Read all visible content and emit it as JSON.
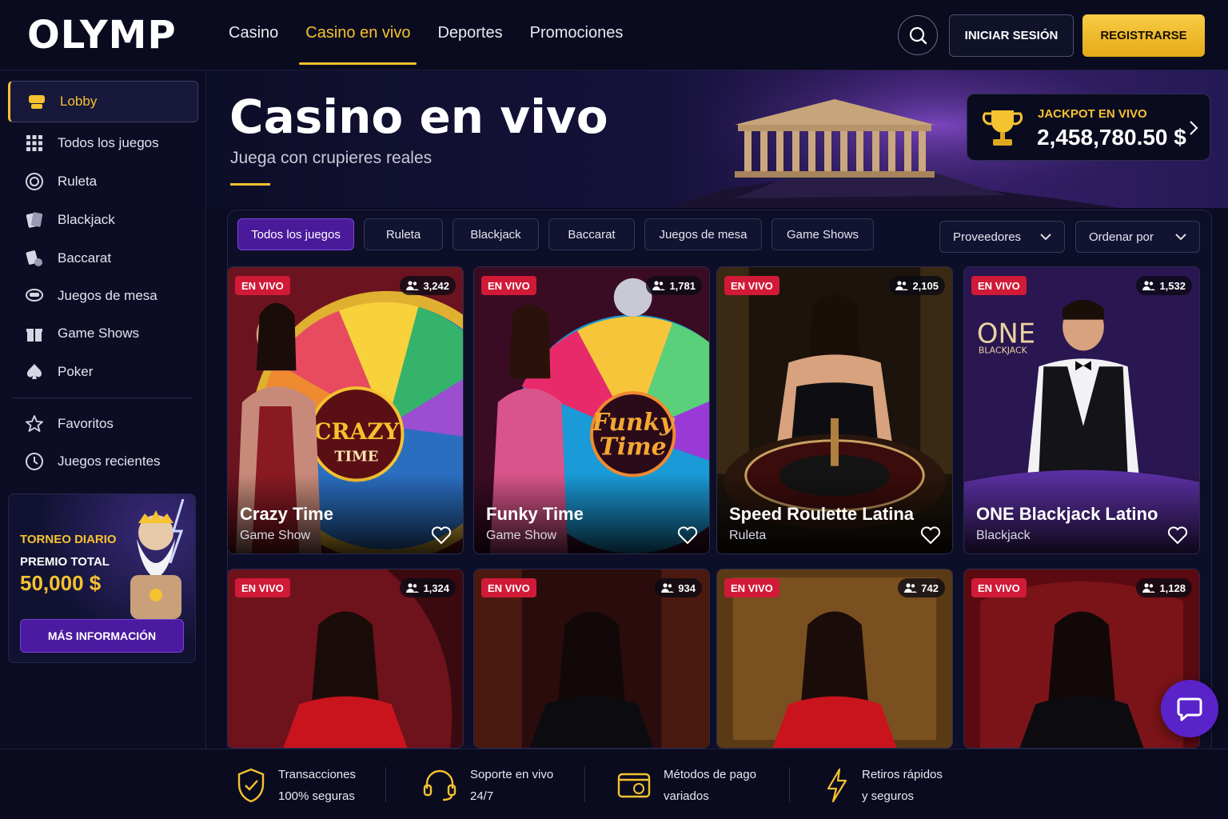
{
  "header": {
    "logo": "OLYMP",
    "nav": [
      "Casino",
      "Casino en vivo",
      "Deportes",
      "Promociones"
    ],
    "login": "INICIAR SESIÓN",
    "register": "REGISTRARSE"
  },
  "sidebar": {
    "items": [
      {
        "label": "Lobby",
        "icon": "lobby-icon"
      },
      {
        "label": "Todos los juegos",
        "icon": "grid-icon"
      },
      {
        "label": "Ruleta",
        "icon": "roulette-icon"
      },
      {
        "label": "Blackjack",
        "icon": "cards-icon"
      },
      {
        "label": "Baccarat",
        "icon": "baccarat-icon"
      },
      {
        "label": "Juegos de mesa",
        "icon": "table-games-icon"
      },
      {
        "label": "Game Shows",
        "icon": "gift-icon"
      },
      {
        "label": "Poker",
        "icon": "spade-icon"
      }
    ],
    "secondary": [
      {
        "label": "Favoritos",
        "icon": "star-icon"
      },
      {
        "label": "Juegos recientes",
        "icon": "clock-icon"
      }
    ],
    "promo": {
      "title": "TORNEO DIARIO",
      "subtitle": "PREMIO TOTAL",
      "amount": "50,000 $",
      "button": "MÁS INFORMACIÓN"
    }
  },
  "hero": {
    "title": "Casino en vivo",
    "subtitle": "Juega con crupieres reales",
    "jackpot_label": "JACKPOT EN VIVO",
    "jackpot_value": "2,458,780.50 $"
  },
  "filters": [
    "Todos los juegos",
    "Ruleta",
    "Blackjack",
    "Baccarat",
    "Juegos de mesa",
    "Game Shows"
  ],
  "dropdowns": [
    "Proveedores",
    "Ordenar por"
  ],
  "live_label": "EN VIVO",
  "games": [
    {
      "name": "Crazy Time",
      "category": "Game Show",
      "players": "3,242",
      "logo": "CRAZY TIME"
    },
    {
      "name": "Funky Time",
      "category": "Game Show",
      "players": "1,781",
      "logo": "Funky Time"
    },
    {
      "name": "Speed Roulette Latina",
      "category": "Ruleta",
      "players": "2,105"
    },
    {
      "name": "ONE Blackjack Latino",
      "category": "Blackjack",
      "players": "1,532",
      "logo": "ONE BLACKJACK"
    },
    {
      "name": "",
      "category": "",
      "players": "1,324"
    },
    {
      "name": "",
      "category": "",
      "players": "934"
    },
    {
      "name": "",
      "category": "",
      "players": "742"
    },
    {
      "name": "",
      "category": "",
      "players": "1,128"
    }
  ],
  "footer": [
    {
      "line1": "Transacciones",
      "line2": "100% seguras",
      "icon": "shield-check-icon"
    },
    {
      "line1": "Soporte en vivo",
      "line2": "24/7",
      "icon": "headset-icon"
    },
    {
      "line1": "Métodos de pago",
      "line2": "variados",
      "icon": "wallet-icon"
    },
    {
      "line1": "Retiros rápidos",
      "line2": "y seguros",
      "icon": "lightning-icon"
    }
  ],
  "colors": {
    "accent": "#f5c230",
    "live": "#d11a37",
    "purple": "#4a1a9a",
    "bg": "#0b0c22"
  }
}
